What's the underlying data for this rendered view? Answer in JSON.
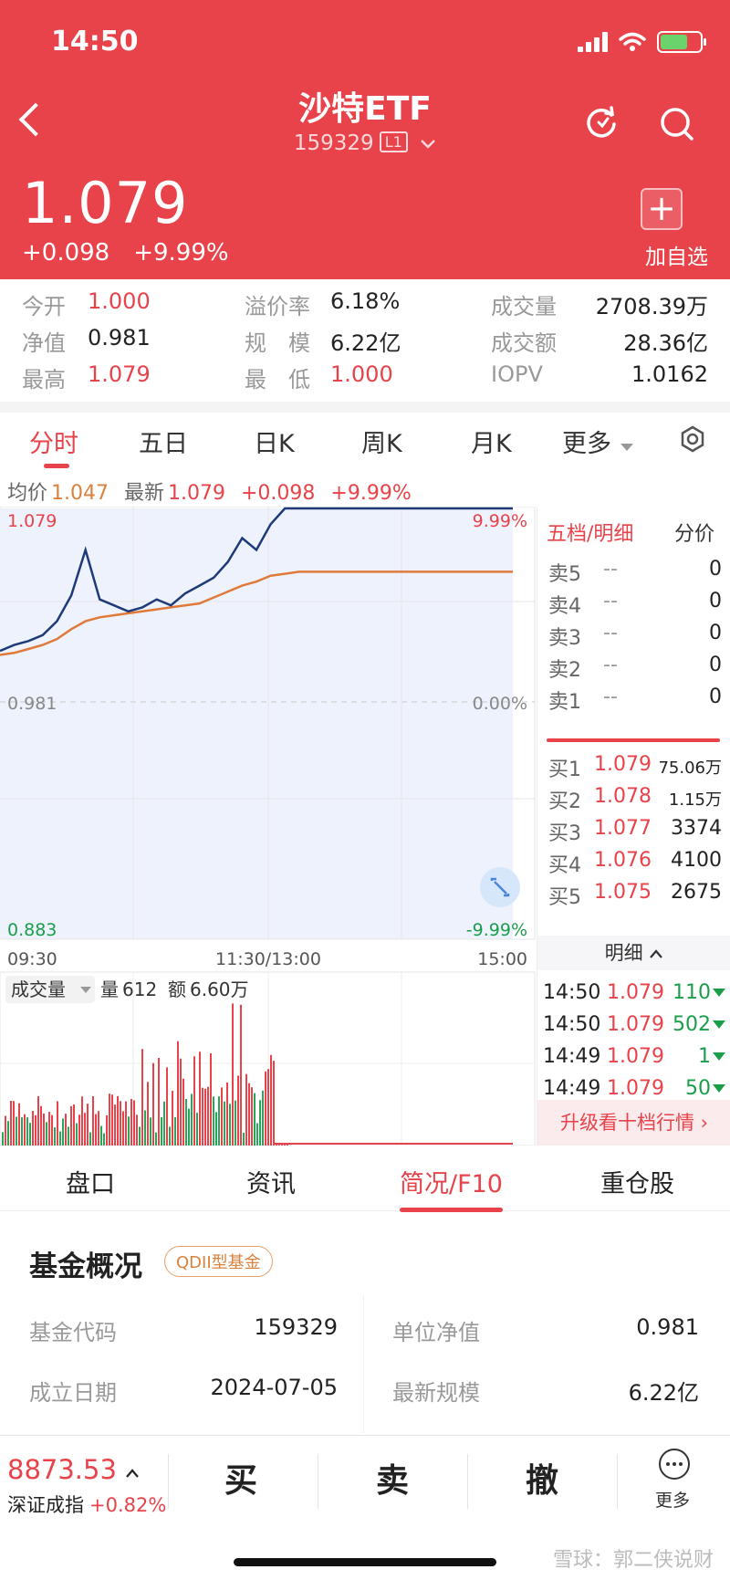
{
  "status": {
    "time": "14:50"
  },
  "header": {
    "title": "沙特ETF",
    "code": "159329",
    "level_tag": "L1",
    "price": "1.079",
    "change": "+0.098",
    "change_pct": "+9.99%",
    "add_label": "加自选"
  },
  "quote": {
    "open": {
      "label": "今开",
      "value": "1.000"
    },
    "premium": {
      "label": "溢价率",
      "value": "6.18%"
    },
    "volume": {
      "label": "成交量",
      "value": "2708.39万"
    },
    "nav": {
      "label": "净值",
      "value": "0.981"
    },
    "scale": {
      "label": "规　模",
      "value": "6.22亿"
    },
    "amount": {
      "label": "成交额",
      "value": "28.36亿"
    },
    "high": {
      "label": "最高",
      "value": "1.079"
    },
    "low": {
      "label": "最　低",
      "value": "1.000"
    },
    "iopv": {
      "label": "IOPV",
      "value": "1.0162"
    }
  },
  "chart_tabs": [
    "分时",
    "五日",
    "日K",
    "周K",
    "月K",
    "更多"
  ],
  "stats": {
    "avg_label": "均价",
    "avg": "1.047",
    "latest_label": "最新",
    "latest": "1.079",
    "change": "+0.098",
    "change_pct": "+9.99%"
  },
  "chart_data": {
    "type": "line",
    "x_ticks": [
      "09:30",
      "11:30/13:00",
      "15:00"
    ],
    "y_left": [
      "1.079",
      "0.981",
      "0.883"
    ],
    "y_right": [
      "9.99%",
      "0.00%",
      "-9.99%"
    ],
    "ylim": [
      0.883,
      1.079
    ],
    "price_series": [
      1.007,
      1.01,
      1.012,
      1.015,
      1.022,
      1.035,
      1.058,
      1.033,
      1.03,
      1.027,
      1.029,
      1.033,
      1.03,
      1.036,
      1.04,
      1.044,
      1.052,
      1.064,
      1.058,
      1.071,
      1.079,
      1.079,
      1.079,
      1.079,
      1.079,
      1.079,
      1.079,
      1.079,
      1.079,
      1.079,
      1.079,
      1.079,
      1.079,
      1.079,
      1.079,
      1.079,
      1.079
    ],
    "avg_series": [
      1.005,
      1.006,
      1.008,
      1.01,
      1.013,
      1.018,
      1.022,
      1.024,
      1.025,
      1.026,
      1.027,
      1.028,
      1.029,
      1.03,
      1.031,
      1.034,
      1.037,
      1.04,
      1.042,
      1.045,
      1.046,
      1.047,
      1.047,
      1.047,
      1.047,
      1.047,
      1.047,
      1.047,
      1.047,
      1.047,
      1.047,
      1.047,
      1.047,
      1.047,
      1.047,
      1.047,
      1.047
    ],
    "volume_label": "成交量",
    "vol_label": "量",
    "vol_value": "612",
    "amt_label": "额",
    "amt_value": "6.60万"
  },
  "orderbook": {
    "tab1": "五档/明细",
    "tab2": "分价",
    "asks": [
      {
        "label": "卖5",
        "price": "--",
        "vol": "0"
      },
      {
        "label": "卖4",
        "price": "--",
        "vol": "0"
      },
      {
        "label": "卖3",
        "price": "--",
        "vol": "0"
      },
      {
        "label": "卖2",
        "price": "--",
        "vol": "0"
      },
      {
        "label": "卖1",
        "price": "--",
        "vol": "0"
      }
    ],
    "bids": [
      {
        "label": "买1",
        "price": "1.079",
        "vol": "75.06万"
      },
      {
        "label": "买2",
        "price": "1.078",
        "vol": "1.15万"
      },
      {
        "label": "买3",
        "price": "1.077",
        "vol": "3374"
      },
      {
        "label": "买4",
        "price": "1.076",
        "vol": "4100"
      },
      {
        "label": "买5",
        "price": "1.075",
        "vol": "2675"
      }
    ],
    "detail_label": "明细",
    "ticks": [
      {
        "time": "14:50",
        "price": "1.079",
        "vol": "110"
      },
      {
        "time": "14:50",
        "price": "1.079",
        "vol": "502"
      },
      {
        "time": "14:49",
        "price": "1.079",
        "vol": "1"
      },
      {
        "time": "14:49",
        "price": "1.079",
        "vol": "50"
      }
    ],
    "upgrade": "升级看十档行情 ›"
  },
  "bottom_tabs": [
    "盘口",
    "资讯",
    "简况/F10",
    "重仓股"
  ],
  "fund": {
    "title": "基金概况",
    "tag": "QDII型基金",
    "code_label": "基金代码",
    "code": "159329",
    "nav_label": "单位净值",
    "nav": "0.981",
    "date_label": "成立日期",
    "date": "2024-07-05",
    "scale_label": "最新规模",
    "scale": "6.22亿"
  },
  "bottom_bar": {
    "index_value": "8873.53",
    "index_name": "深证成指",
    "index_change": "+0.82%",
    "buy": "买",
    "sell": "卖",
    "cancel": "撤",
    "more": "更多"
  },
  "watermark": "雪球：郭二侠说财"
}
